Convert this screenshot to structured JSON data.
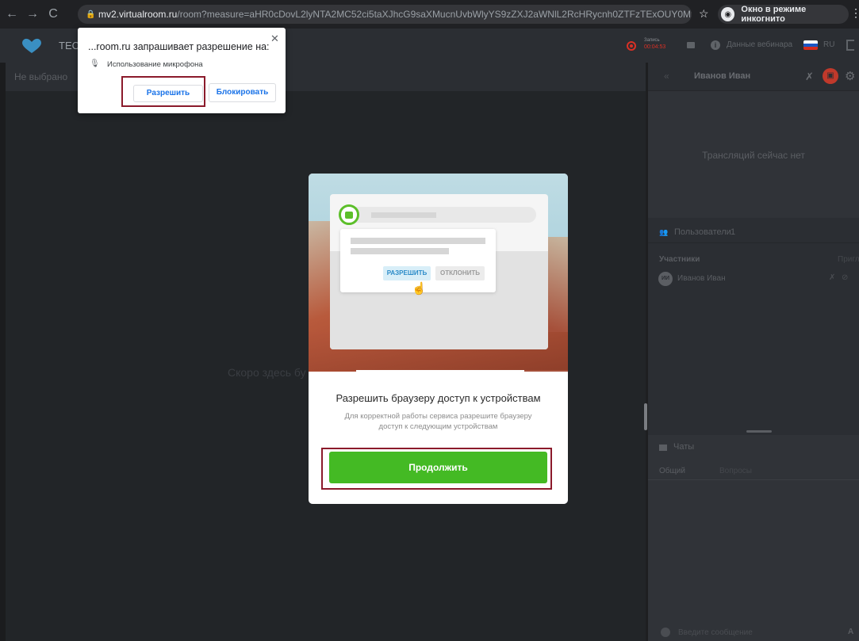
{
  "browser": {
    "url_host": "mv2.virtualroom.ru",
    "url_path": "/room?measure=aHR0cDovL2lyNTA2MC52ci5taXJhcG9saXMucnUvbWlyYS9zZXJ2aWNlL2RcHRycnh0ZTFzTExOUY0MzJi...",
    "incognito_label": "Окно в режиме инкогнито",
    "icons": [
      "back-icon",
      "forward-icon",
      "reload-icon",
      "lock-icon",
      "star-icon",
      "incognito-icon",
      "menu-icon"
    ]
  },
  "app_header": {
    "event_name": "ТЕС",
    "rec_label": "Запись",
    "rec_time": "00:04:53",
    "webinar_data": "Данные вебинара",
    "lang": "RU",
    "colors": {
      "rec": "#d93025",
      "header_bg": "#2b2e33"
    }
  },
  "main": {
    "not_selected": "Не выбрано",
    "soon_text": "Скоро здесь бу"
  },
  "right_panel": {
    "presenter_name": "Иванов Иван",
    "no_stream": "Трансляций сейчас нет",
    "users_title": "Пользователи",
    "users_count": "1",
    "participants_label": "Участники",
    "invite_label": "Пригл",
    "user": {
      "initials": "ИИ",
      "name": "Иванов Иван"
    },
    "chat_title": "Чаты",
    "chat_tabs": [
      "Общий",
      "Вопросы"
    ],
    "message_placeholder": "Введите сообщение",
    "font_label": "A"
  },
  "permission_popup": {
    "title": "...room.ru запрашивает разрешение на:",
    "mic_text": "Использование микрофона",
    "allow_label": "Разрешить",
    "block_label": "Блокировать",
    "close_glyph": "✕",
    "colors": {
      "highlight": "#8b1a2b",
      "link": "#1a73e8"
    }
  },
  "modal": {
    "mock_allow": "РАЗРЕШИТЬ",
    "mock_decline": "ОТКЛОНИТЬ",
    "title": "Разрешить браузеру доступ к устройствам",
    "description": "Для корректной работы сервиса разрешите браузеру доступ к следующим устройствам",
    "continue_label": "Продолжить",
    "colors": {
      "continue": "#44ba24",
      "highlight": "#8b1a2b"
    }
  }
}
